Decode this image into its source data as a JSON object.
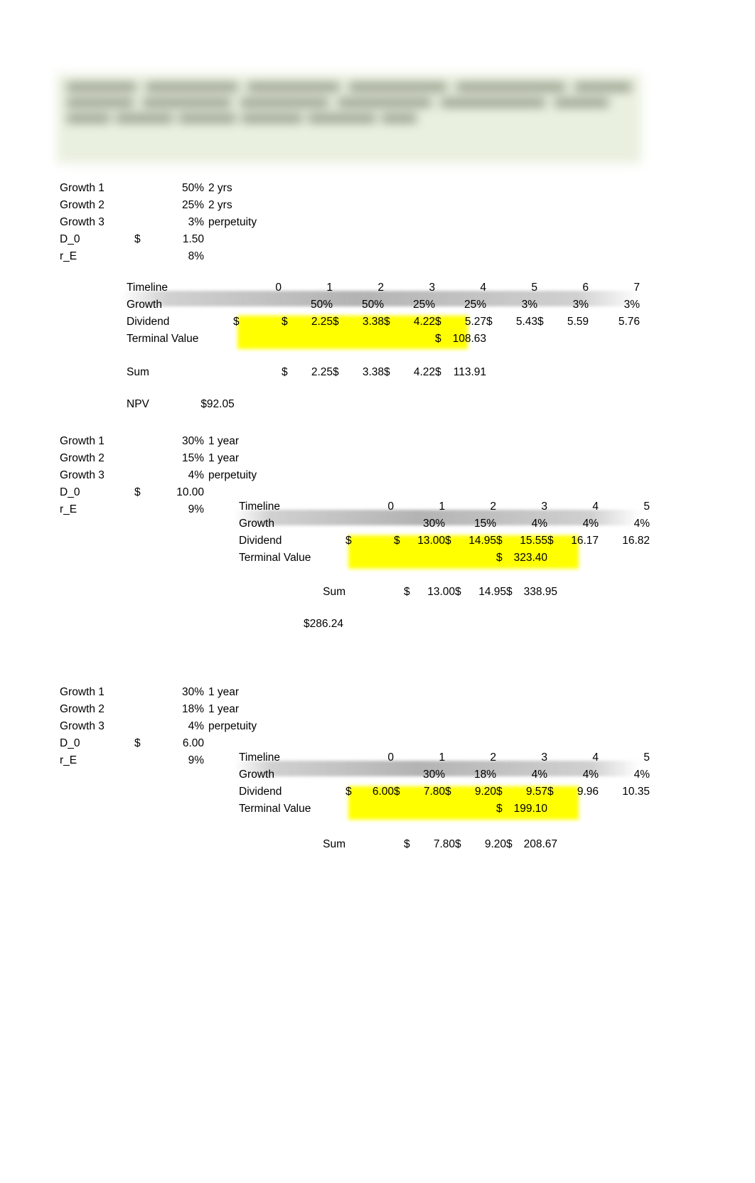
{
  "document": {
    "title": "Dividend Discount Model — Multistage Growth Worksheet",
    "header_banner": {
      "state": "redacted-blurred",
      "background_color": "#eaf0e0",
      "text_color": "#8b9380"
    },
    "highlight_color": "#ffff00",
    "band_color": "#969696"
  },
  "blocks": [
    {
      "id": "block-1",
      "params": [
        {
          "label": "Growth 1",
          "currency": "",
          "value": "50%",
          "note": "2 yrs"
        },
        {
          "label": "Growth 2",
          "currency": "",
          "value": "25%",
          "note": "2 yrs"
        },
        {
          "label": "Growth 3",
          "currency": "",
          "value": "3%",
          "note": "perpetuity"
        },
        {
          "label": "D_0",
          "currency": "$",
          "value": "1.50",
          "note": ""
        },
        {
          "label": "r_E",
          "currency": "",
          "value": "8%",
          "note": ""
        }
      ],
      "table": {
        "timeline_label": "Timeline",
        "periods": [
          "0",
          "1",
          "2",
          "3",
          "4",
          "5",
          "6",
          "7"
        ],
        "growth_label": "Growth",
        "growth": [
          "",
          "50%",
          "50%",
          "25%",
          "25%",
          "3%",
          "3%",
          "3%"
        ],
        "dividend_label": "Dividend",
        "dividend_currency": [
          "$",
          "$",
          "$",
          "$",
          "$",
          "$",
          "$",
          ""
        ],
        "dividend": [
          "",
          "2.25",
          "3.38",
          "4.22",
          "5.27",
          "5.43",
          "5.59",
          "5.76"
        ],
        "terminal_label": "Terminal Value",
        "terminal_currency": "$",
        "terminal_value": "108.63",
        "terminal_period_index": 4
      },
      "sum": {
        "label": "Sum",
        "currency": [
          "$",
          "$",
          "$",
          "$"
        ],
        "values": [
          "2.25",
          "3.38",
          "4.22",
          "113.91"
        ]
      },
      "npv": {
        "label": "NPV",
        "value": "$92.05"
      }
    },
    {
      "id": "block-2",
      "params": [
        {
          "label": "Growth 1",
          "currency": "",
          "value": "30%",
          "note": "1 year"
        },
        {
          "label": "Growth 2",
          "currency": "",
          "value": "15%",
          "note": "1 year"
        },
        {
          "label": "Growth 3",
          "currency": "",
          "value": "4%",
          "note": "perpetuity"
        },
        {
          "label": "D_0",
          "currency": "$",
          "value": "10.00",
          "note": ""
        },
        {
          "label": "r_E",
          "currency": "",
          "value": "9%",
          "note": ""
        }
      ],
      "table": {
        "timeline_label": "Timeline",
        "periods": [
          "0",
          "1",
          "2",
          "3",
          "4",
          "5"
        ],
        "growth_label": "Growth",
        "growth": [
          "",
          "30%",
          "15%",
          "4%",
          "4%",
          "4%"
        ],
        "dividend_label": "Dividend",
        "dividend_currency": [
          "$",
          "$",
          "$",
          "$",
          "$",
          ""
        ],
        "dividend": [
          "",
          "13.00",
          "14.95",
          "15.55",
          "16.17",
          "16.82"
        ],
        "terminal_label": "Terminal Value",
        "terminal_currency": "$",
        "terminal_value": "323.40",
        "terminal_period_index": 3
      },
      "sum": {
        "label": "Sum",
        "currency": [
          "$",
          "$",
          "$"
        ],
        "values": [
          "13.00",
          "14.95",
          "338.95"
        ]
      },
      "npv": {
        "label": "",
        "value": "$286.24"
      }
    },
    {
      "id": "block-3",
      "params": [
        {
          "label": "Growth 1",
          "currency": "",
          "value": "30%",
          "note": "1 year"
        },
        {
          "label": "Growth 2",
          "currency": "",
          "value": "18%",
          "note": "1 year"
        },
        {
          "label": "Growth 3",
          "currency": "",
          "value": "4%",
          "note": "perpetuity"
        },
        {
          "label": "D_0",
          "currency": "$",
          "value": "6.00",
          "note": ""
        },
        {
          "label": "r_E",
          "currency": "",
          "value": "9%",
          "note": ""
        }
      ],
      "table": {
        "timeline_label": "Timeline",
        "periods": [
          "0",
          "1",
          "2",
          "3",
          "4",
          "5"
        ],
        "growth_label": "Growth",
        "growth": [
          "",
          "30%",
          "18%",
          "4%",
          "4%",
          "4%"
        ],
        "dividend_label": "Dividend",
        "dividend_currency": [
          "$",
          "$",
          "$",
          "$",
          "$",
          ""
        ],
        "dividend": [
          "6.00",
          "7.80",
          "9.20",
          "9.57",
          "9.96",
          "10.35"
        ],
        "terminal_label": "Terminal Value",
        "terminal_currency": "$",
        "terminal_value": "199.10",
        "terminal_period_index": 3
      },
      "sum": {
        "label": "Sum",
        "currency": [
          "$",
          "$",
          "$"
        ],
        "values": [
          "7.80",
          "9.20",
          "208.67"
        ]
      },
      "npv": {
        "label": "",
        "value": ""
      }
    }
  ]
}
